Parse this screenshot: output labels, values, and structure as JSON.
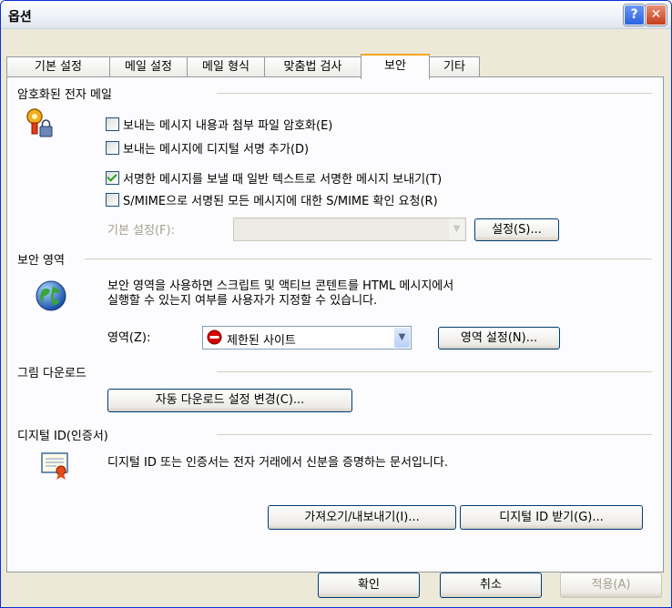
{
  "window": {
    "title": "옵션",
    "help_label": "?",
    "close_label": "✕"
  },
  "tabs": [
    {
      "label": "기본 설정"
    },
    {
      "label": "메일 설정"
    },
    {
      "label": "메일 형식"
    },
    {
      "label": "맞춤법 검사"
    },
    {
      "label": "보안",
      "active": true
    },
    {
      "label": "기타"
    }
  ],
  "encrypted_mail": {
    "section_title": "암호화된 전자 메일",
    "icon": "key-lock-icon",
    "options": [
      {
        "label": "보내는 메시지 내용과 첨부 파일 암호화(E)",
        "checked": false
      },
      {
        "label": "보내는 메시지에 디지털 서명 추가(D)",
        "checked": false
      },
      {
        "label": "서명한 메시지를 보낼 때 일반 텍스트로 서명한 메시지 보내기(T)",
        "checked": true
      },
      {
        "label": "S/MIME으로 서명된 모든 메시지에 대한 S/MIME 확인 요청(R)",
        "checked": false
      }
    ],
    "default_settings_label": "기본 설정(F):",
    "default_settings_value": "",
    "settings_button": "설정(S)..."
  },
  "security_zone": {
    "section_title": "보안 영역",
    "icon": "globe-icon",
    "description_line1": "보안 영역을 사용하면 스크립트 및 액티브 콘텐트를 HTML 메시지에서",
    "description_line2": "실행할 수 있는지 여부를 사용자가 지정할 수 있습니다.",
    "zone_label": "영역(Z):",
    "zone_value": "제한된 사이트",
    "zone_icon": "restricted-icon",
    "zone_settings_button": "영역 설정(N)..."
  },
  "picture_download": {
    "section_title": "그림 다운로드",
    "change_button": "자동 다운로드 설정 변경(C)..."
  },
  "digital_id": {
    "section_title": "디지털 ID(인증서)",
    "icon": "certificate-icon",
    "description": "디지털 ID 또는 인증서는 전자 거래에서 신분을 증명하는 문서입니다.",
    "import_export_button": "가져오기/내보내기(I)...",
    "get_id_button": "디지털 ID 받기(G)..."
  },
  "footer": {
    "ok": "확인",
    "cancel": "취소",
    "apply": "적용(A)"
  },
  "colors": {
    "title_accent": "#0831d9",
    "tab_highlight": "#f7a61e",
    "checkmark": "#21a121",
    "restricted": "#d40000"
  }
}
